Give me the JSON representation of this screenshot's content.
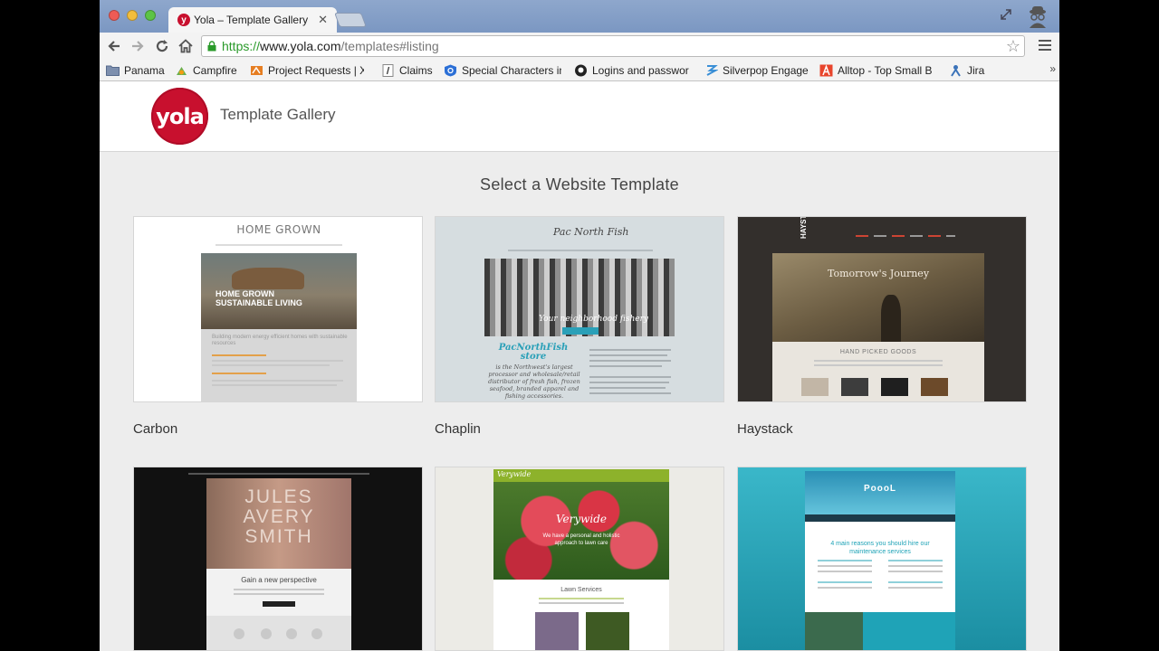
{
  "browser": {
    "tab_title": "Yola – Template Gallery",
    "tab_favicon": "y",
    "url_scheme": "https://",
    "url_host": "www.yola.com",
    "url_path": "/templates#listing",
    "bookmarks": [
      "Panama",
      "Campfire",
      "Project Requests | X",
      "Claims",
      "Special Characters in",
      "Logins and passwor",
      "Silverpop Engage",
      "Alltop - Top Small B",
      "Jira"
    ]
  },
  "header": {
    "logo_text": "yola",
    "title": "Template Gallery"
  },
  "gallery": {
    "heading": "Select a Website Template",
    "templates": [
      {
        "name": "Carbon"
      },
      {
        "name": "Chaplin"
      },
      {
        "name": "Haystack"
      }
    ]
  },
  "thumbs": {
    "carbon": {
      "title": "HOME GROWN",
      "hero": "HOME GROWN SUSTAINABLE LIVING",
      "tagline": "Building modern energy efficient homes with sustainable resources"
    },
    "chaplin": {
      "logo": "Pac North Fish",
      "hero": "Your neighborhood fishery",
      "store": "PacNorthFish store",
      "lead": "is the Northwest's largest processor and wholesale/retail distributor of fresh fish, frozen seafood, branded apparel and fishing accessories."
    },
    "haystack": {
      "logo": "HAYSTACK",
      "hero": "Tomorrow's Journey",
      "section": "HAND PICKED GOODS"
    },
    "jules": {
      "hero": "JULES AVERY SMITH",
      "tag": "Gain a new perspective"
    },
    "verdant": {
      "logo": "Verywide",
      "hero": "Verywide",
      "tag": "We have a personal and holistic approach to lawn care",
      "section": "Lawn Services"
    },
    "poool": {
      "logo": "PoooL",
      "heading": "4 main reasons you should hire our maintenance services"
    }
  },
  "colors": {
    "yola_red": "#c8102e",
    "chaplin_teal": "#2aa0b8",
    "verdant_green": "#8db22b",
    "poool_teal": "#1fa3b7"
  }
}
